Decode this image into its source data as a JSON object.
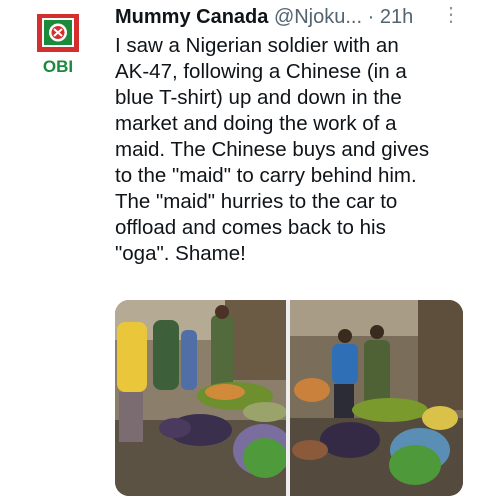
{
  "tweet": {
    "display_name": "Mummy Canada",
    "handle": "@Njoku...",
    "separator": "·",
    "time": "21h",
    "more_icon": "vertical-ellipsis-icon",
    "avatar": {
      "label": "OBI",
      "colors": {
        "red": "#d32f2f",
        "green": "#1b8a3b"
      }
    },
    "text": "I saw a Nigerian soldier with an\nAK-47, following a Chinese (in a\nblue T-shirt) up and down in the\nmarket and doing the work of a\nmaid. The Chinese buys and gives\nto the \"maid\" to carry behind him.\nThe \"maid\" hurries to the car to\noffload and comes back to his\n\"oga\". Shame!",
    "media_count": 2
  }
}
